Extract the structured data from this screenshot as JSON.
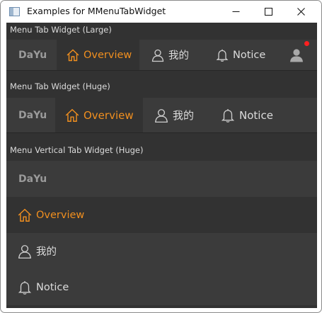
{
  "window": {
    "title": "Examples for MMenuTabWidget",
    "icons": {
      "app": "window-app-icon",
      "minimize": "minimize-icon",
      "maximize": "maximize-icon",
      "close": "close-icon"
    }
  },
  "large": {
    "label": "Menu Tab Widget (Large)",
    "logo": "DaYu",
    "tabs": [
      {
        "label": "Overview",
        "icon": "home-icon",
        "checked": true
      },
      {
        "label": "我的",
        "icon": "user-icon",
        "checked": false
      },
      {
        "label": "Notice",
        "icon": "bell-icon",
        "checked": false
      }
    ],
    "avatar_icon": "avatar-icon"
  },
  "huge": {
    "label": "Menu Tab Widget (Huge)",
    "logo": "DaYu",
    "tabs": [
      {
        "label": "Overview",
        "icon": "home-icon",
        "checked": true
      },
      {
        "label": "我的",
        "icon": "user-icon",
        "checked": false
      },
      {
        "label": "Notice",
        "icon": "bell-icon",
        "checked": false
      }
    ]
  },
  "vertical": {
    "label": "Menu Vertical Tab Widget (Huge)",
    "logo": "DaYu",
    "tabs": [
      {
        "label": "Overview",
        "icon": "home-icon",
        "checked": true
      },
      {
        "label": "我的",
        "icon": "user-icon",
        "checked": false
      },
      {
        "label": "Notice",
        "icon": "bell-icon",
        "checked": false
      }
    ]
  },
  "colors": {
    "accent": "#f08f1f",
    "background": "#323232",
    "tab_bar": "#3b3b3b",
    "text": "#dcdcdc",
    "badge": "#ff2020"
  }
}
